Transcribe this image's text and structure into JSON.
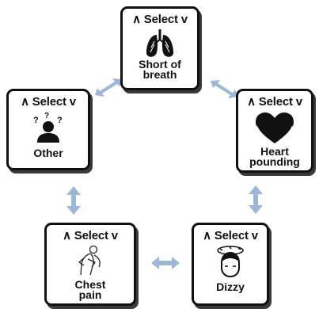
{
  "selector_label": "∧ Select v",
  "symptoms": {
    "short_of_breath": {
      "label": "Short of\nbreath",
      "icon": "lungs-icon"
    },
    "heart_pounding": {
      "label": "Heart\npounding",
      "icon": "heart-icon"
    },
    "dizzy": {
      "label": "Dizzy",
      "icon": "dizzy-head-icon"
    },
    "chest_pain": {
      "label": "Chest\npain",
      "icon": "chest-pain-person-icon"
    },
    "other": {
      "label": "Other",
      "icon": "question-person-icon"
    }
  },
  "colors": {
    "arrow": "#9db7d9",
    "border": "#111111"
  }
}
